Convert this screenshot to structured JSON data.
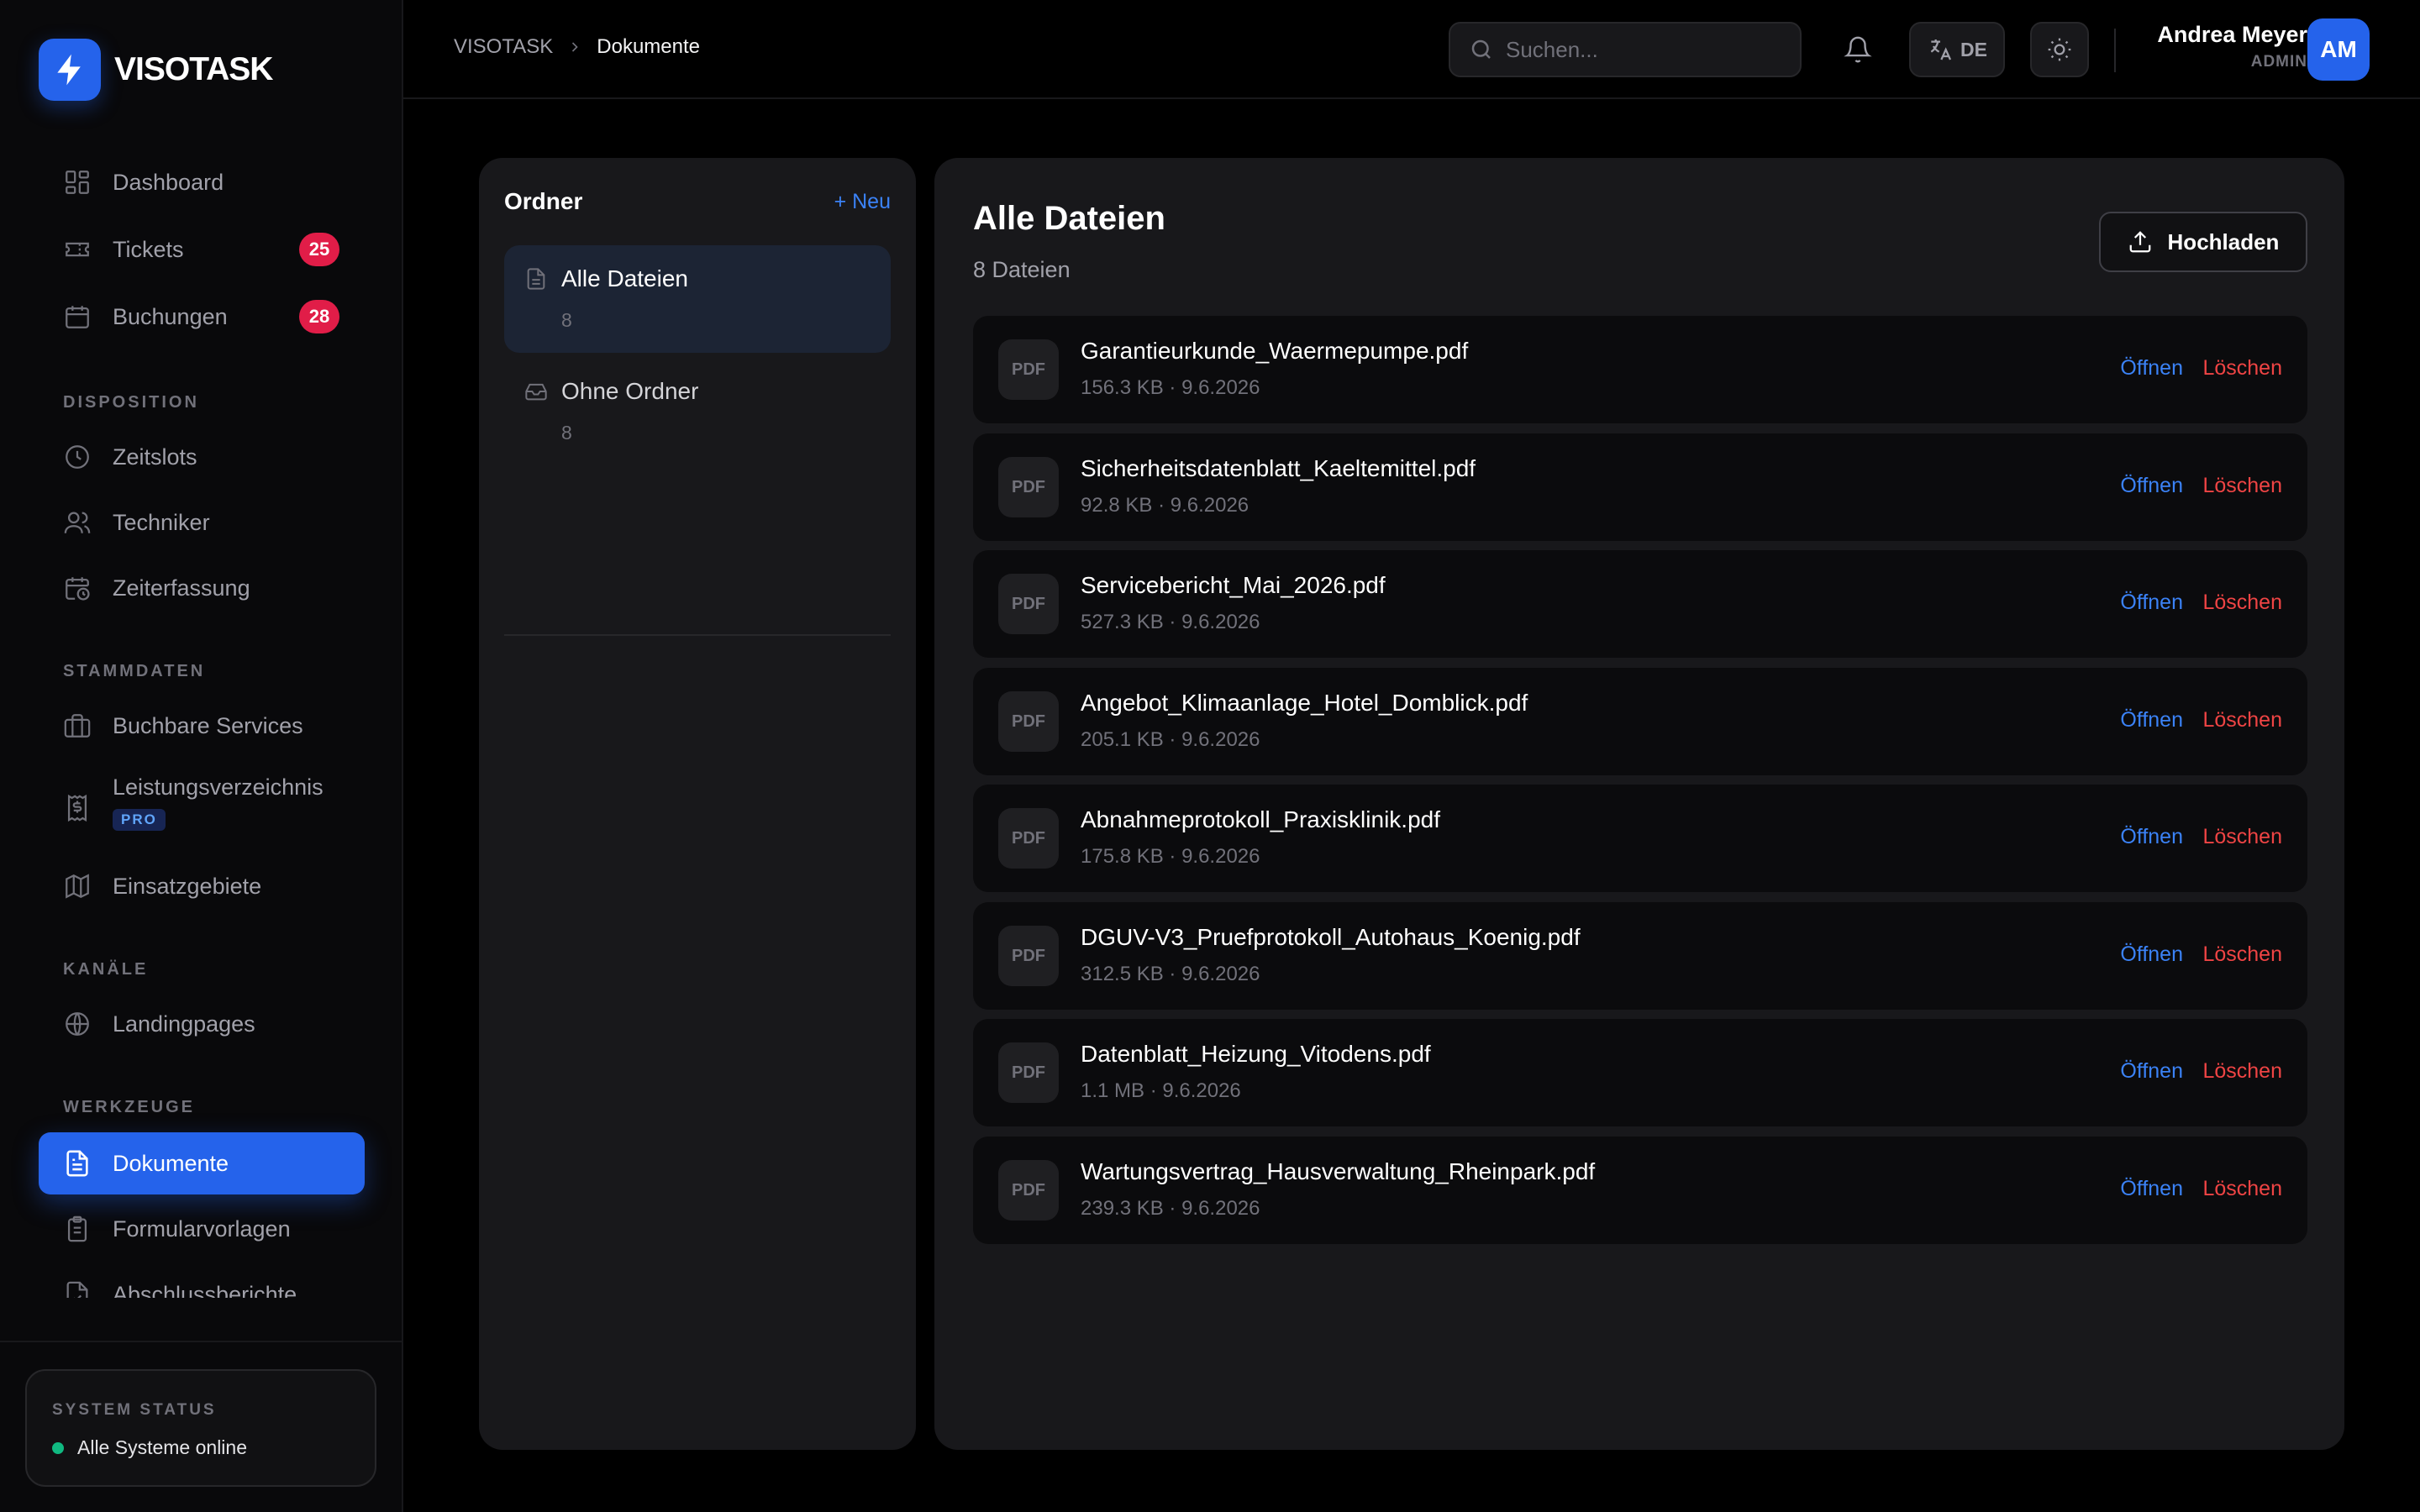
{
  "brand": {
    "name": "VISOTASK",
    "icon": "bolt-icon",
    "accent": "#2563eb"
  },
  "sidebar": {
    "nav": [
      {
        "label": "Dashboard",
        "icon": "dashboard-icon"
      },
      {
        "label": "Tickets",
        "icon": "ticket-icon",
        "badge": "25"
      },
      {
        "label": "Buchungen",
        "icon": "calendar-icon",
        "badge": "28"
      }
    ],
    "sections": [
      {
        "title": "DISPOSITION",
        "items": [
          {
            "label": "Zeitslots",
            "icon": "clock-icon"
          },
          {
            "label": "Techniker",
            "icon": "users-icon"
          },
          {
            "label": "Zeiterfassung",
            "icon": "calendar-clock-icon"
          }
        ]
      },
      {
        "title": "STAMMDATEN",
        "items": [
          {
            "label": "Buchbare Services",
            "icon": "briefcase-icon"
          },
          {
            "label": "Leistungsverzeichnis",
            "icon": "receipt-icon",
            "tag": "PRO"
          },
          {
            "label": "Einsatzgebiete",
            "icon": "map-icon"
          }
        ]
      },
      {
        "title": "KANÄLE",
        "items": [
          {
            "label": "Landingpages",
            "icon": "globe-icon"
          }
        ]
      },
      {
        "title": "WERKZEUGE",
        "items": [
          {
            "label": "Dokumente",
            "icon": "document-icon",
            "active": true
          },
          {
            "label": "Formularvorlagen",
            "icon": "clipboard-icon"
          },
          {
            "label": "Abschlussberichte",
            "icon": "report-icon"
          }
        ]
      }
    ],
    "status": {
      "title": "SYSTEM STATUS",
      "text": "Alle Systeme online",
      "color": "#10b981"
    }
  },
  "topbar": {
    "breadcrumb": {
      "root": "VISOTASK",
      "current": "Dokumente"
    },
    "search": {
      "placeholder": "Suchen...",
      "value": ""
    },
    "language": "DE",
    "user": {
      "name": "Andrea Meyer",
      "role": "ADMIN",
      "initials": "AM"
    }
  },
  "folders": {
    "title": "Ordner",
    "new_label": "+ Neu",
    "items": [
      {
        "name": "Alle Dateien",
        "count": "8",
        "icon": "document-icon",
        "active": true
      },
      {
        "name": "Ohne Ordner",
        "count": "8",
        "icon": "inbox-icon"
      }
    ]
  },
  "files": {
    "title": "Alle Dateien",
    "count": "8 Dateien",
    "upload_label": "Hochladen",
    "open_label": "Öffnen",
    "delete_label": "Löschen",
    "type_label": "PDF",
    "items": [
      {
        "name": "Garantieurkunde_Waermepumpe.pdf",
        "meta": "156.3 KB · 9.6.2026"
      },
      {
        "name": "Sicherheitsdatenblatt_Kaeltemittel.pdf",
        "meta": "92.8 KB · 9.6.2026"
      },
      {
        "name": "Servicebericht_Mai_2026.pdf",
        "meta": "527.3 KB · 9.6.2026"
      },
      {
        "name": "Angebot_Klimaanlage_Hotel_Domblick.pdf",
        "meta": "205.1 KB · 9.6.2026"
      },
      {
        "name": "Abnahmeprotokoll_Praxisklinik.pdf",
        "meta": "175.8 KB · 9.6.2026"
      },
      {
        "name": "DGUV-V3_Pruefprotokoll_Autohaus_Koenig.pdf",
        "meta": "312.5 KB · 9.6.2026"
      },
      {
        "name": "Datenblatt_Heizung_Vitodens.pdf",
        "meta": "1.1 MB · 9.6.2026"
      },
      {
        "name": "Wartungsvertrag_Hausverwaltung_Rheinpark.pdf",
        "meta": "239.3 KB · 9.6.2026"
      }
    ]
  }
}
